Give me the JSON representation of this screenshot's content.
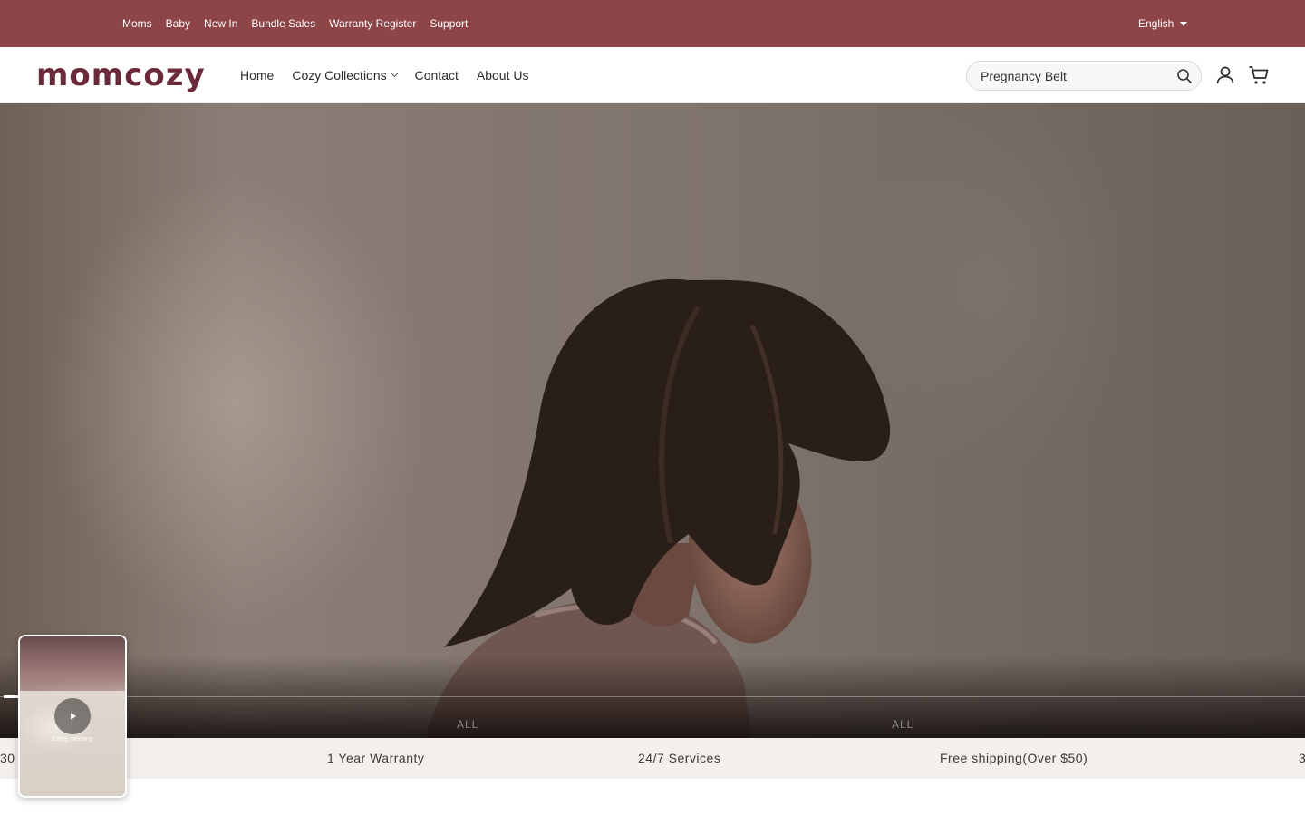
{
  "topbar": {
    "links": [
      "Moms",
      "Baby",
      "New In",
      "Bundle Sales",
      "Warranty Register",
      "Support"
    ],
    "language": "English"
  },
  "header": {
    "logo": "momcozy",
    "nav": [
      {
        "label": "Home",
        "has_dropdown": false
      },
      {
        "label": "Cozy Collections",
        "has_dropdown": true
      },
      {
        "label": "Contact",
        "has_dropdown": false
      },
      {
        "label": "About Us",
        "has_dropdown": false
      }
    ],
    "search": {
      "placeholder": "Pregnancy Belt",
      "icon": "search-icon"
    },
    "icons": [
      "account-icon",
      "cart-icon"
    ]
  },
  "hero": {
    "tabs": [
      "ALL",
      "ALL"
    ],
    "progress": 0.011
  },
  "benefits": [
    "30 …",
    "1 Year Warranty",
    "24/7 Services",
    "Free shipping(Over $50)",
    "3"
  ],
  "video_card": {
    "caption": "Every morning",
    "icon": "play-icon"
  },
  "colors": {
    "topbar": "#8e4547",
    "logo": "#6b2a3a",
    "benefit_strip": "#f3efeb"
  }
}
